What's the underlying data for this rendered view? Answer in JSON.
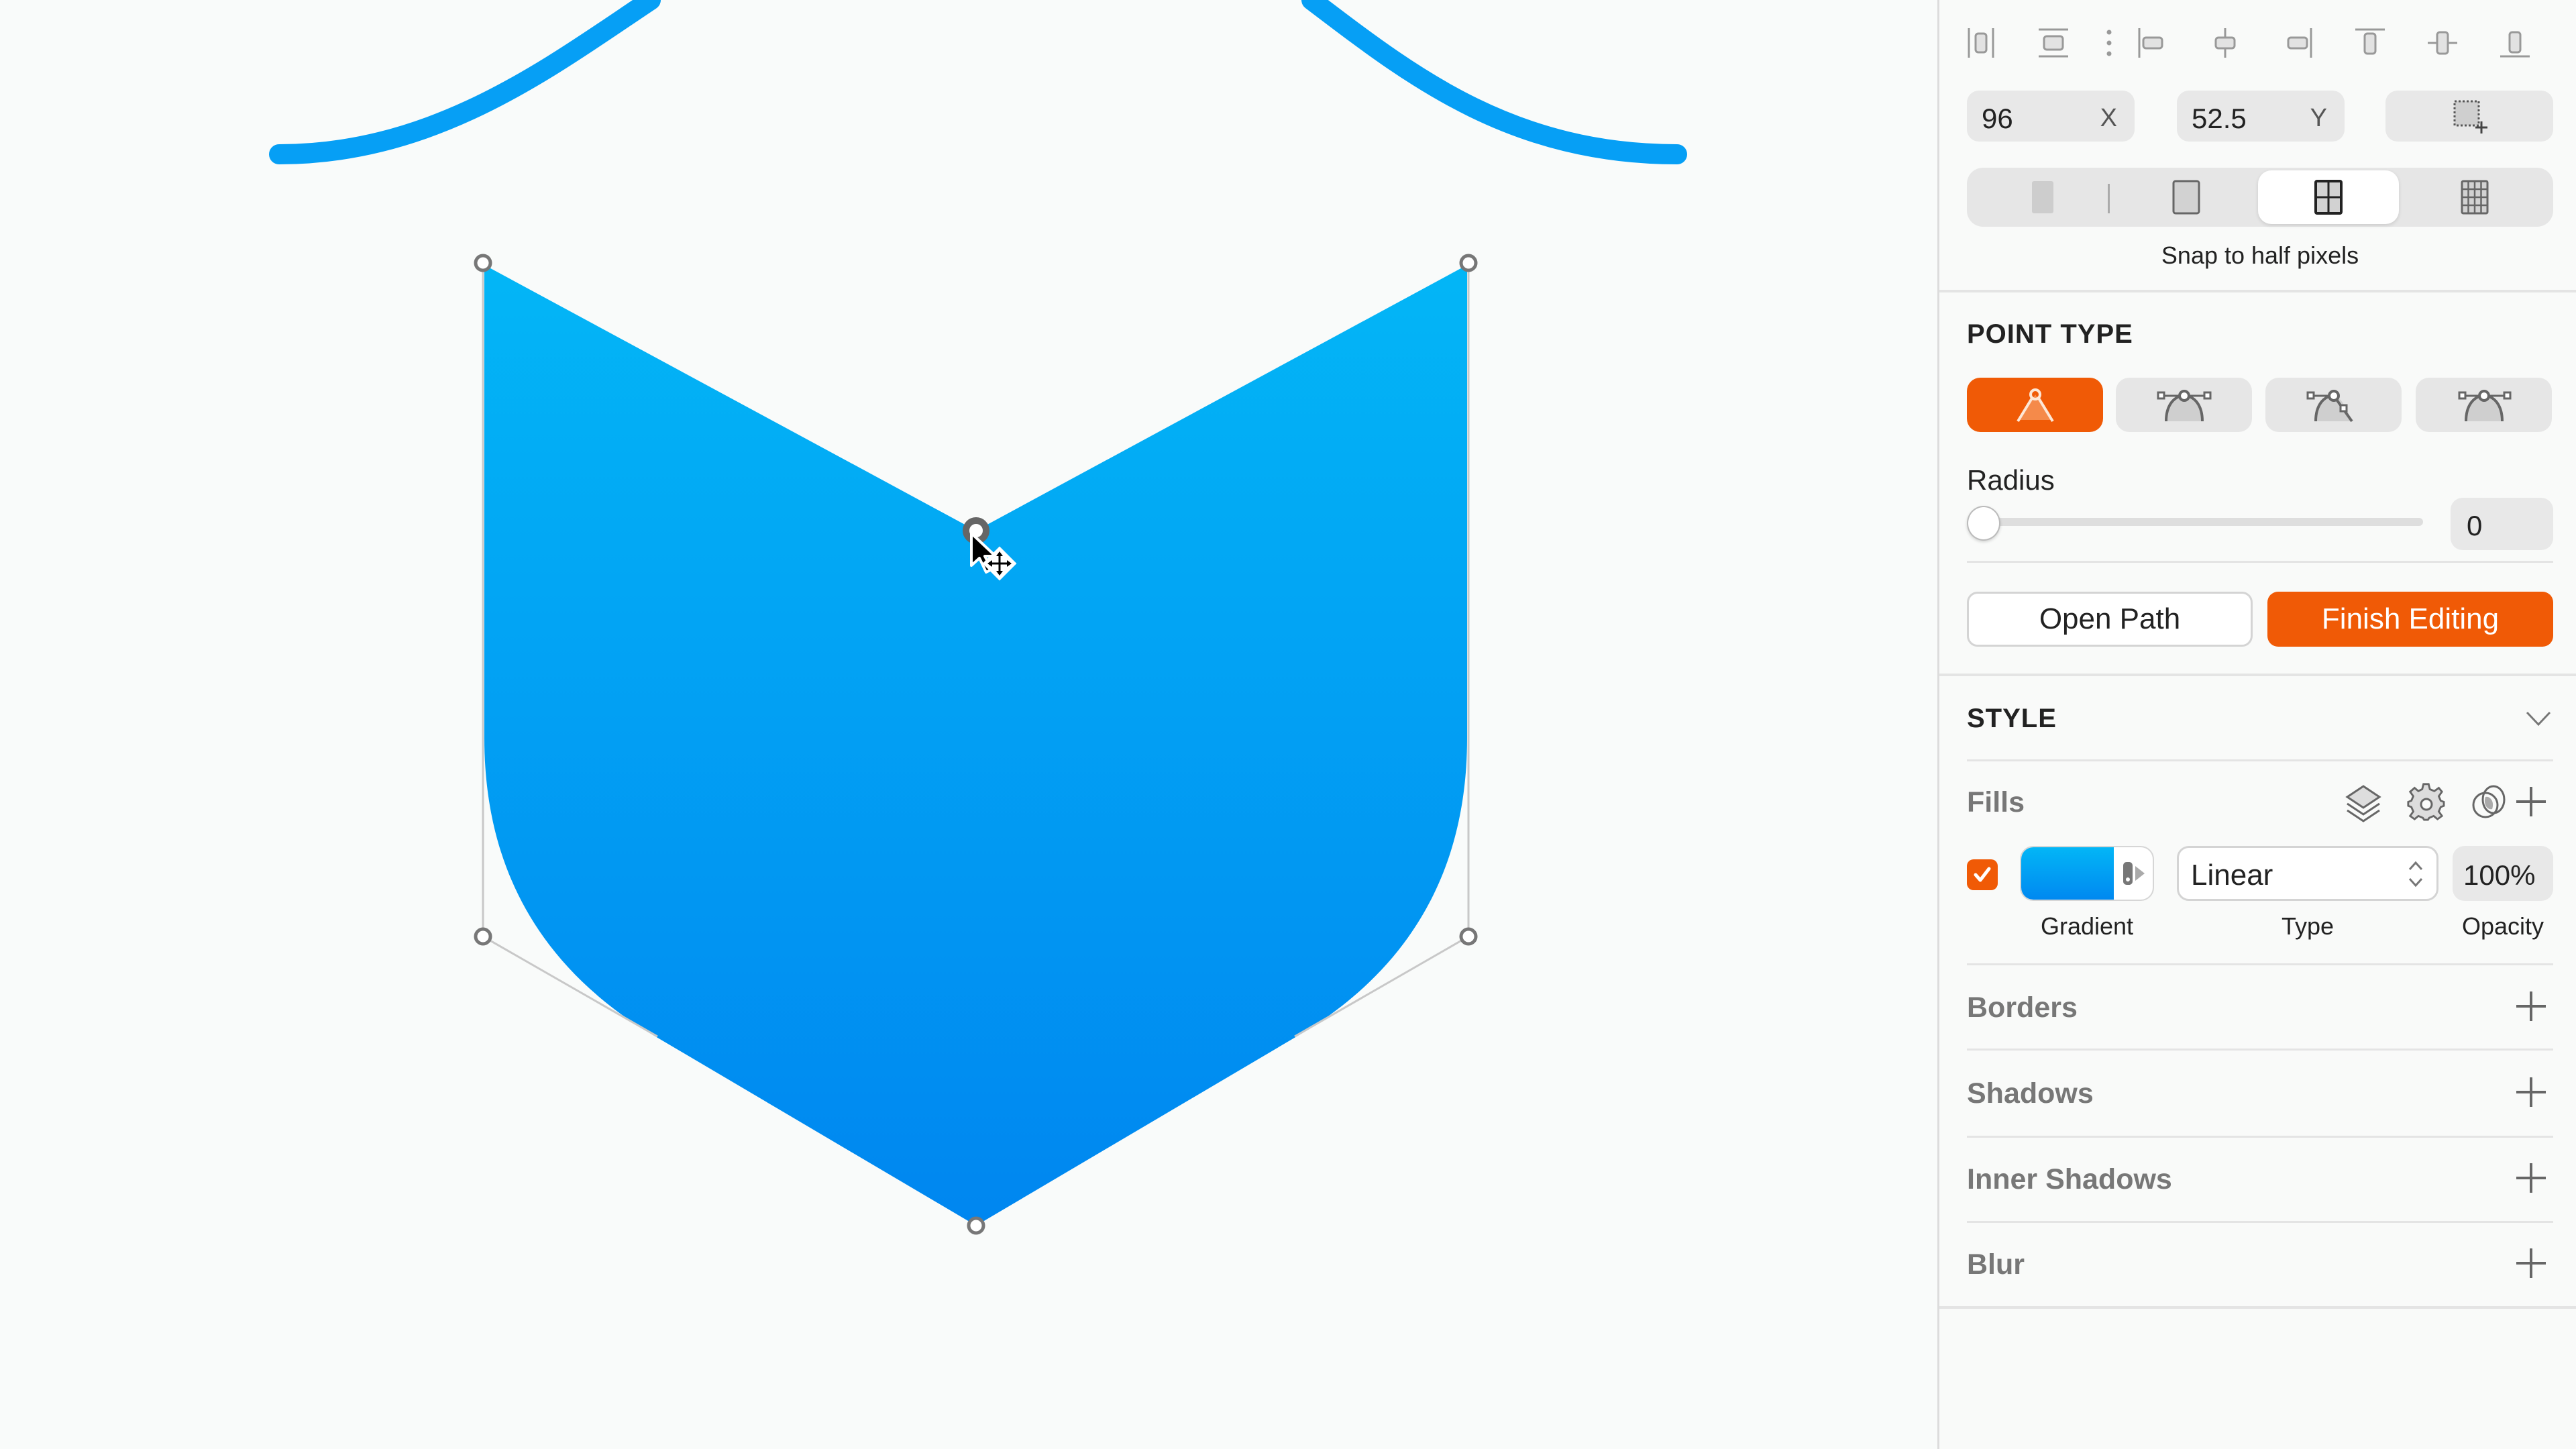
{
  "canvas": {
    "shape": {
      "name": "chevron-shield-path",
      "fill_gradient": {
        "type": "Linear",
        "start_color": "#03b6f6",
        "end_color": "#0086f0"
      },
      "selected_point": "inner-vertex",
      "cursor": "move-point-cursor"
    },
    "curve_stroke_color": "#069ff5"
  },
  "inspector": {
    "alignment_tools": [
      "distribute-horizontally",
      "distribute-vertically",
      "more",
      "align-left",
      "align-horizontal-center",
      "align-right",
      "align-top",
      "align-vertical-center",
      "align-bottom"
    ],
    "position": {
      "x_value": "96",
      "x_label": "X",
      "y_value": "52.5",
      "y_label": "Y"
    },
    "snap": {
      "options": [
        "no-snapping",
        "snap-full-pixels",
        "snap-half-pixels",
        "snap-grid"
      ],
      "selected_index": 2,
      "caption": "Snap to half pixels"
    },
    "point_type": {
      "title": "POINT TYPE",
      "options": [
        "Straight",
        "Mirrored",
        "Disconnected",
        "Asymmetric"
      ],
      "selected_index": 0
    },
    "radius": {
      "label": "Radius",
      "value": "0",
      "slider_fraction": 0
    },
    "buttons": {
      "open_path": "Open Path",
      "finish_editing": "Finish Editing"
    },
    "style": {
      "title": "STYLE",
      "fills": {
        "title": "Fills",
        "enabled": true,
        "fill_label": "Gradient",
        "type_value": "Linear",
        "type_label": "Type",
        "opacity_value": "100%",
        "opacity_label": "Opacity"
      },
      "sections": [
        "Borders",
        "Shadows",
        "Inner Shadows",
        "Blur"
      ]
    },
    "accent_color": "#f05a06"
  }
}
